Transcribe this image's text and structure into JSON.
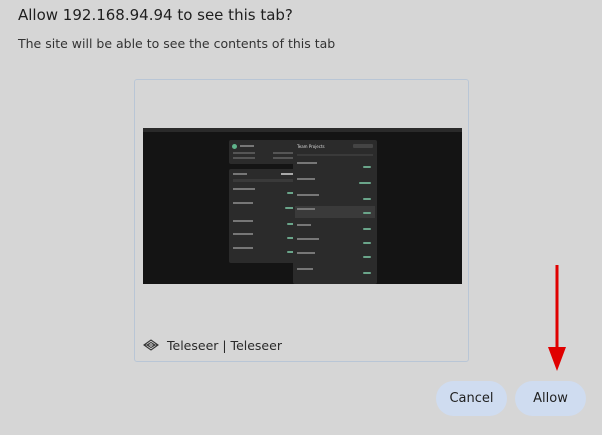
{
  "dialog": {
    "title": "Allow 192.168.94.94 to see this tab?",
    "subtitle": "The site will be able to see the contents of this tab"
  },
  "preview": {
    "tab_title": "Teleseer | Teleseer",
    "thumbnail_heading": "Team Projects"
  },
  "buttons": {
    "cancel_label": "Cancel",
    "allow_label": "Allow"
  },
  "colors": {
    "dialog_bg": "#d6d6d6",
    "button_bg": "#cfdcf0",
    "card_border": "#b9c6d6",
    "annotation_arrow": "#e00000"
  }
}
